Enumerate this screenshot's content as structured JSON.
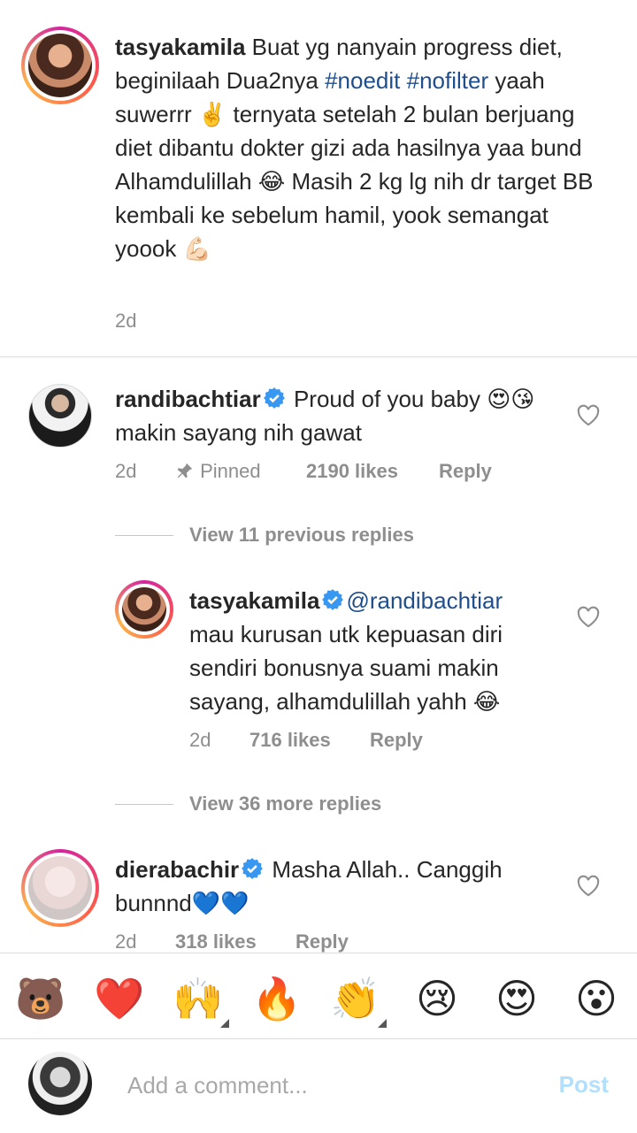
{
  "caption": {
    "username": "tasyakamila",
    "text_1": " Buat yg nanyain progress diet, beginilaah  Dua2nya ",
    "tag_1": "#noedit",
    "tag_2": "#nofilter",
    "text_2": " yaah suwerrr ✌️ ternyata setelah 2 bulan berjuang diet dibantu dokter gizi ada hasilnya yaa bund Alhamdulillah 😂 Masih 2 kg lg nih dr target BB kembali ke sebelum hamil, yook semangat yoook 💪🏻",
    "time": "2d"
  },
  "comments": [
    {
      "username": "randibachtiar",
      "text": " Proud of you baby 😍😘 makin sayang nih gawat",
      "time": "2d",
      "pinned": "Pinned",
      "likes": "2190 likes",
      "reply": "Reply"
    },
    {
      "username": "tasyakamila",
      "mention": "@randibachtiar",
      "text": " mau kurusan utk kepuasan diri sendiri bonusnya suami makin sayang, alhamdulillah yahh 😂",
      "time": "2d",
      "likes": "716 likes",
      "reply": "Reply"
    },
    {
      "username": "dierabachir",
      "text": " Masha Allah.. Canggih bunnnd💙💙",
      "time": "2d",
      "likes": "318 likes",
      "reply": "Reply"
    }
  ],
  "view_previous": "View 11 previous replies",
  "view_more": "View 36 more replies",
  "emoji_bar": [
    "🐻",
    "❤️",
    "🙌",
    "🔥",
    "👏",
    "😢",
    "😍",
    "😮"
  ],
  "composer": {
    "placeholder": "Add a comment...",
    "post_label": "Post"
  },
  "colors": {
    "text": "#262626",
    "muted": "#8e8e8e",
    "hashtag": "#1f4e8c",
    "verified": "#3897f0",
    "post_disabled": "#b2dffc"
  }
}
